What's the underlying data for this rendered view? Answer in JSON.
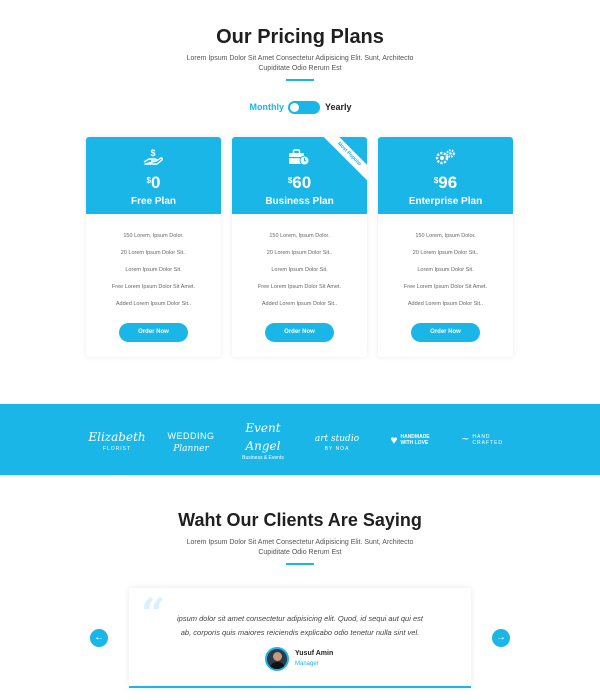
{
  "pricing": {
    "title": "Our Pricing Plans",
    "subtitle_line1": "Lorem Ipsum Dolor Sit Amet Consectetur Adipisicing Elit. Sunt, Architecto",
    "subtitle_line2": "Cupiditate Odio Rerum Est",
    "toggle": {
      "monthly": "Monthly",
      "yearly": "Yearly",
      "selected": "Yearly"
    },
    "plans": [
      {
        "name": "Free Plan",
        "currency": "$",
        "price": "0",
        "icon": "hand-dollar-icon",
        "features": [
          "150 Lorem, Ipsum Dolor.",
          "20 Lorem Ipsum Dolor Sit..",
          "Lorem Ipsum Dolor Sit.",
          "Free Lorem Ipsum Dolor Sit Amet.",
          "Added Lorem Ipsum Dolor Sit.."
        ],
        "button": "Order Now"
      },
      {
        "name": "Business Plan",
        "currency": "$",
        "price": "60",
        "icon": "briefcase-clock-icon",
        "ribbon": "Most Popular",
        "features": [
          "150 Lorem, Ipsum Dolor.",
          "20 Lorem Ipsum Dolor Sit..",
          "Lorem Ipsum Dolor Sit.",
          "Free Lorem Ipsum Dolor Sit Amet.",
          "Added Lorem Ipsum Dolor Sit.."
        ],
        "button": "Order Now"
      },
      {
        "name": "Enterprise Plan",
        "currency": "$",
        "price": "96",
        "icon": "gears-icon",
        "features": [
          "150 Lorem, Ipsum Dolor.",
          "20 Lorem Ipsum Dolor Sit..",
          "Lorem Ipsum Dolor Sit.",
          "Free Lorem Ipsum Dolor Sit Amet.",
          "Added Lorem Ipsum Dolor Sit.."
        ],
        "button": "Order Now"
      }
    ]
  },
  "logos": [
    {
      "main": "Elizabeth",
      "sub": "FLORIST"
    },
    {
      "main": "WEDDING",
      "sub": "Planner"
    },
    {
      "main": "Event Angel",
      "sub": "Business & Events"
    },
    {
      "main": "art studio",
      "sub": "BY NOA"
    },
    {
      "main": "HANDMADE",
      "sub": "WITH LOVE"
    },
    {
      "main": "HAND",
      "sub": "CRAFTED"
    }
  ],
  "testimonials": {
    "title": "Waht Our Clients Are Saying",
    "subtitle_line1": "Lorem Ipsum Dolor Sit Amet Consectetur Adipisicing Elit. Sunt, Architecto",
    "subtitle_line2": "Cupiditate Odio Rerum Est",
    "quote_line1": "ipsum dolor sit amet consectetur adipisicing elit. Quod, id sequi aut qui est",
    "quote_line2": "ab, corporis quis maiores reiciendis explicabo odio tenetur nulla sint vel.",
    "name": "Yusuf Amin",
    "role": "Manager",
    "prev": "←",
    "next": "→"
  },
  "colors": {
    "accent": "#1bb6e8",
    "text": "#1f1f1f"
  }
}
